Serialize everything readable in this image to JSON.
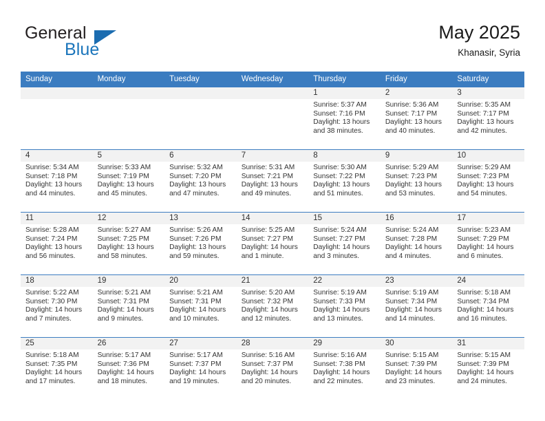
{
  "brand": {
    "name_part1": "General",
    "name_part2": "Blue",
    "accent_color": "#1b75bb",
    "triangle_color": "#1b6cb0"
  },
  "header": {
    "title": "May 2025",
    "subtitle": "Khanasir, Syria"
  },
  "theme": {
    "header_row_bg": "#3b7cc0",
    "daynum_bg": "#f2f2f2",
    "grid_line": "#3b7cc0",
    "text": "#333333"
  },
  "weekdays": [
    "Sunday",
    "Monday",
    "Tuesday",
    "Wednesday",
    "Thursday",
    "Friday",
    "Saturday"
  ],
  "weeks": [
    [
      {
        "day": "",
        "empty": true
      },
      {
        "day": "",
        "empty": true
      },
      {
        "day": "",
        "empty": true
      },
      {
        "day": "",
        "empty": true
      },
      {
        "day": "1",
        "sunrise": "Sunrise: 5:37 AM",
        "sunset": "Sunset: 7:16 PM",
        "daylight": "Daylight: 13 hours and 38 minutes."
      },
      {
        "day": "2",
        "sunrise": "Sunrise: 5:36 AM",
        "sunset": "Sunset: 7:17 PM",
        "daylight": "Daylight: 13 hours and 40 minutes."
      },
      {
        "day": "3",
        "sunrise": "Sunrise: 5:35 AM",
        "sunset": "Sunset: 7:17 PM",
        "daylight": "Daylight: 13 hours and 42 minutes."
      }
    ],
    [
      {
        "day": "4",
        "sunrise": "Sunrise: 5:34 AM",
        "sunset": "Sunset: 7:18 PM",
        "daylight": "Daylight: 13 hours and 44 minutes."
      },
      {
        "day": "5",
        "sunrise": "Sunrise: 5:33 AM",
        "sunset": "Sunset: 7:19 PM",
        "daylight": "Daylight: 13 hours and 45 minutes."
      },
      {
        "day": "6",
        "sunrise": "Sunrise: 5:32 AM",
        "sunset": "Sunset: 7:20 PM",
        "daylight": "Daylight: 13 hours and 47 minutes."
      },
      {
        "day": "7",
        "sunrise": "Sunrise: 5:31 AM",
        "sunset": "Sunset: 7:21 PM",
        "daylight": "Daylight: 13 hours and 49 minutes."
      },
      {
        "day": "8",
        "sunrise": "Sunrise: 5:30 AM",
        "sunset": "Sunset: 7:22 PM",
        "daylight": "Daylight: 13 hours and 51 minutes."
      },
      {
        "day": "9",
        "sunrise": "Sunrise: 5:29 AM",
        "sunset": "Sunset: 7:23 PM",
        "daylight": "Daylight: 13 hours and 53 minutes."
      },
      {
        "day": "10",
        "sunrise": "Sunrise: 5:29 AM",
        "sunset": "Sunset: 7:23 PM",
        "daylight": "Daylight: 13 hours and 54 minutes."
      }
    ],
    [
      {
        "day": "11",
        "sunrise": "Sunrise: 5:28 AM",
        "sunset": "Sunset: 7:24 PM",
        "daylight": "Daylight: 13 hours and 56 minutes."
      },
      {
        "day": "12",
        "sunrise": "Sunrise: 5:27 AM",
        "sunset": "Sunset: 7:25 PM",
        "daylight": "Daylight: 13 hours and 58 minutes."
      },
      {
        "day": "13",
        "sunrise": "Sunrise: 5:26 AM",
        "sunset": "Sunset: 7:26 PM",
        "daylight": "Daylight: 13 hours and 59 minutes."
      },
      {
        "day": "14",
        "sunrise": "Sunrise: 5:25 AM",
        "sunset": "Sunset: 7:27 PM",
        "daylight": "Daylight: 14 hours and 1 minute."
      },
      {
        "day": "15",
        "sunrise": "Sunrise: 5:24 AM",
        "sunset": "Sunset: 7:27 PM",
        "daylight": "Daylight: 14 hours and 3 minutes."
      },
      {
        "day": "16",
        "sunrise": "Sunrise: 5:24 AM",
        "sunset": "Sunset: 7:28 PM",
        "daylight": "Daylight: 14 hours and 4 minutes."
      },
      {
        "day": "17",
        "sunrise": "Sunrise: 5:23 AM",
        "sunset": "Sunset: 7:29 PM",
        "daylight": "Daylight: 14 hours and 6 minutes."
      }
    ],
    [
      {
        "day": "18",
        "sunrise": "Sunrise: 5:22 AM",
        "sunset": "Sunset: 7:30 PM",
        "daylight": "Daylight: 14 hours and 7 minutes."
      },
      {
        "day": "19",
        "sunrise": "Sunrise: 5:21 AM",
        "sunset": "Sunset: 7:31 PM",
        "daylight": "Daylight: 14 hours and 9 minutes."
      },
      {
        "day": "20",
        "sunrise": "Sunrise: 5:21 AM",
        "sunset": "Sunset: 7:31 PM",
        "daylight": "Daylight: 14 hours and 10 minutes."
      },
      {
        "day": "21",
        "sunrise": "Sunrise: 5:20 AM",
        "sunset": "Sunset: 7:32 PM",
        "daylight": "Daylight: 14 hours and 12 minutes."
      },
      {
        "day": "22",
        "sunrise": "Sunrise: 5:19 AM",
        "sunset": "Sunset: 7:33 PM",
        "daylight": "Daylight: 14 hours and 13 minutes."
      },
      {
        "day": "23",
        "sunrise": "Sunrise: 5:19 AM",
        "sunset": "Sunset: 7:34 PM",
        "daylight": "Daylight: 14 hours and 14 minutes."
      },
      {
        "day": "24",
        "sunrise": "Sunrise: 5:18 AM",
        "sunset": "Sunset: 7:34 PM",
        "daylight": "Daylight: 14 hours and 16 minutes."
      }
    ],
    [
      {
        "day": "25",
        "sunrise": "Sunrise: 5:18 AM",
        "sunset": "Sunset: 7:35 PM",
        "daylight": "Daylight: 14 hours and 17 minutes."
      },
      {
        "day": "26",
        "sunrise": "Sunrise: 5:17 AM",
        "sunset": "Sunset: 7:36 PM",
        "daylight": "Daylight: 14 hours and 18 minutes."
      },
      {
        "day": "27",
        "sunrise": "Sunrise: 5:17 AM",
        "sunset": "Sunset: 7:37 PM",
        "daylight": "Daylight: 14 hours and 19 minutes."
      },
      {
        "day": "28",
        "sunrise": "Sunrise: 5:16 AM",
        "sunset": "Sunset: 7:37 PM",
        "daylight": "Daylight: 14 hours and 20 minutes."
      },
      {
        "day": "29",
        "sunrise": "Sunrise: 5:16 AM",
        "sunset": "Sunset: 7:38 PM",
        "daylight": "Daylight: 14 hours and 22 minutes."
      },
      {
        "day": "30",
        "sunrise": "Sunrise: 5:15 AM",
        "sunset": "Sunset: 7:39 PM",
        "daylight": "Daylight: 14 hours and 23 minutes."
      },
      {
        "day": "31",
        "sunrise": "Sunrise: 5:15 AM",
        "sunset": "Sunset: 7:39 PM",
        "daylight": "Daylight: 14 hours and 24 minutes."
      }
    ]
  ]
}
